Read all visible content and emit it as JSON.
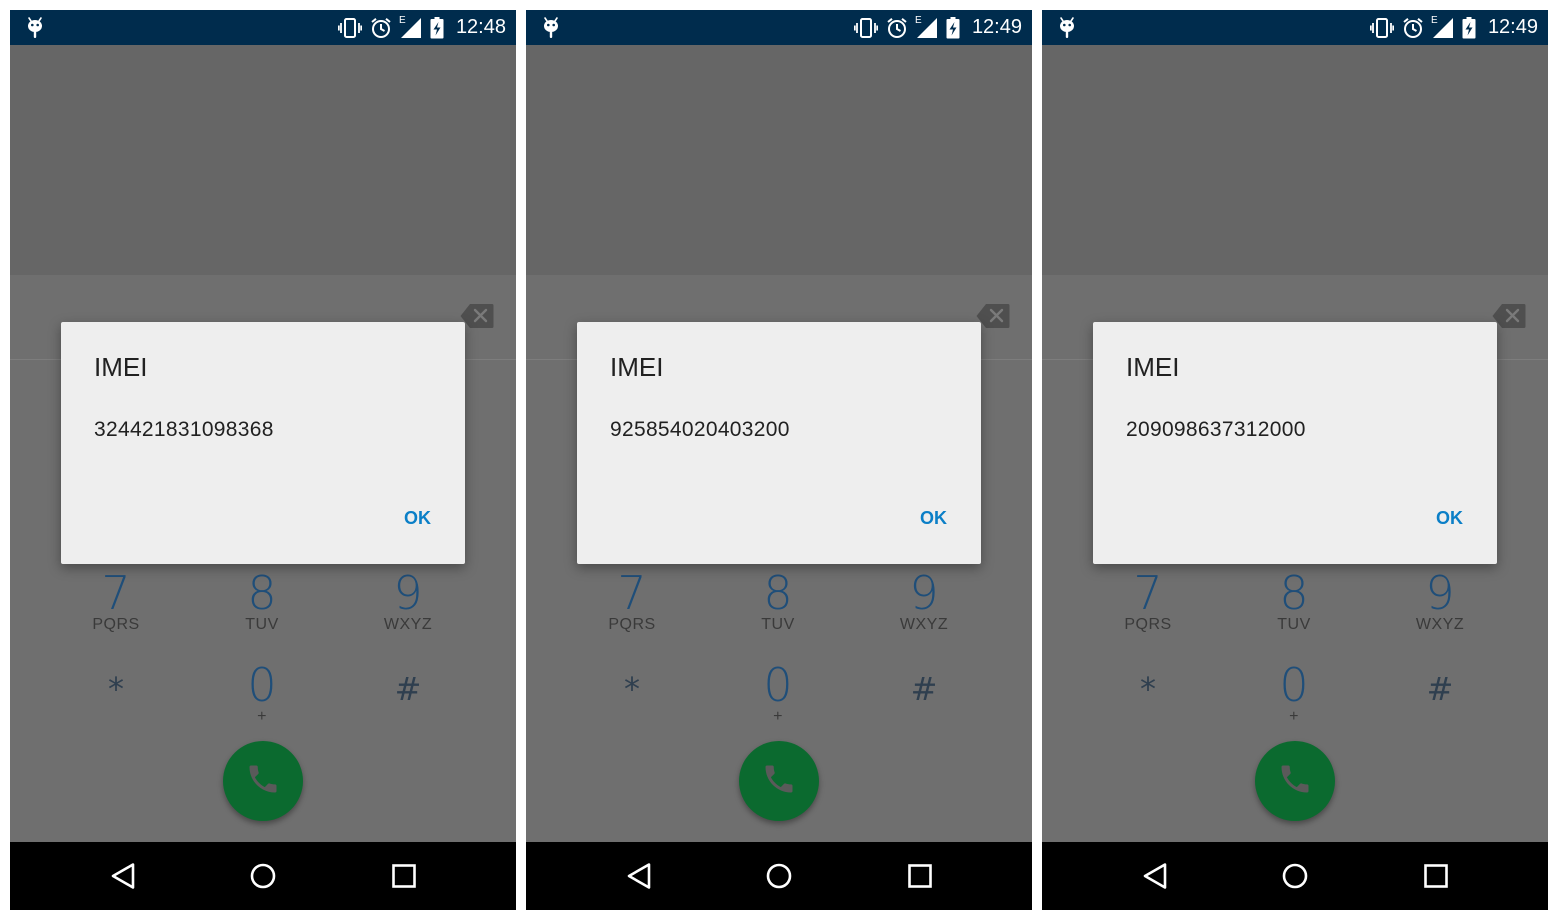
{
  "colors": {
    "status_bar": "#002c4d",
    "screen_dim": "#666666",
    "dialog_bg": "#eeeeee",
    "accent": "#0b7fc7",
    "call_button": "#0b6a2f",
    "digit": "#1f4e79",
    "nav_bar": "#000000"
  },
  "icons": {
    "status": [
      "android-icon",
      "vibrate-icon",
      "alarm-icon",
      "edge-signal-icon",
      "battery-charging-icon"
    ],
    "dialpad": [
      "backspace-icon",
      "phone-icon"
    ],
    "nav": [
      "back-icon",
      "home-icon",
      "recent-apps-icon"
    ]
  },
  "screens": [
    {
      "status": {
        "network": "E",
        "time": "12:48"
      },
      "dialog": {
        "title": "IMEI",
        "message": "324421831098368",
        "ok_label": "OK"
      },
      "dialpad": {
        "keys": [
          {
            "digit": "7",
            "letters": "PQRS"
          },
          {
            "digit": "8",
            "letters": "TUV"
          },
          {
            "digit": "9",
            "letters": "WXYZ"
          },
          {
            "digit": "*",
            "letters": ""
          },
          {
            "digit": "0",
            "letters": "+"
          },
          {
            "digit": "#",
            "letters": ""
          }
        ]
      }
    },
    {
      "status": {
        "network": "E",
        "time": "12:49"
      },
      "dialog": {
        "title": "IMEI",
        "message": "925854020403200",
        "ok_label": "OK"
      },
      "dialpad": {
        "keys": [
          {
            "digit": "7",
            "letters": "PQRS"
          },
          {
            "digit": "8",
            "letters": "TUV"
          },
          {
            "digit": "9",
            "letters": "WXYZ"
          },
          {
            "digit": "*",
            "letters": ""
          },
          {
            "digit": "0",
            "letters": "+"
          },
          {
            "digit": "#",
            "letters": ""
          }
        ]
      }
    },
    {
      "status": {
        "network": "E",
        "time": "12:49"
      },
      "dialog": {
        "title": "IMEI",
        "message": "209098637312000",
        "ok_label": "OK"
      },
      "dialpad": {
        "keys": [
          {
            "digit": "7",
            "letters": "PQRS"
          },
          {
            "digit": "8",
            "letters": "TUV"
          },
          {
            "digit": "9",
            "letters": "WXYZ"
          },
          {
            "digit": "*",
            "letters": ""
          },
          {
            "digit": "0",
            "letters": "+"
          },
          {
            "digit": "#",
            "letters": ""
          }
        ]
      }
    }
  ]
}
